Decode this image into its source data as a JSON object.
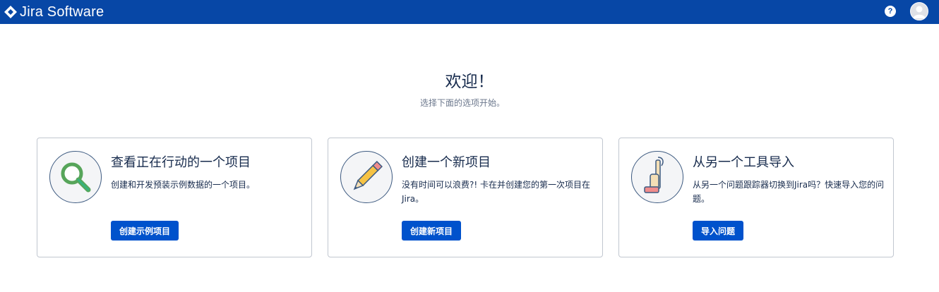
{
  "header": {
    "app_name": "Jira Software",
    "help_label": "?",
    "colors": {
      "bar": "#0747a6",
      "button": "#0052cc"
    }
  },
  "welcome": {
    "title": "欢迎！",
    "subtitle": "选择下面的选项开始。"
  },
  "cards": [
    {
      "icon": "magnifier-icon",
      "title": "查看正在行动的一个项目",
      "description": "创建和开发预装示例数据的一个项目。",
      "button": "创建示例项目"
    },
    {
      "icon": "pencil-icon",
      "title": "创建一个新项目",
      "description": "没有时间可以浪费?! 卡在并创建您的第一次项目在 Jira。",
      "button": "创建新项目"
    },
    {
      "icon": "vacuum-icon",
      "title": "从另一个工具导入",
      "description": "从另一个问题跟踪器切换到Jira吗？快速导入您的问题。",
      "button": "导入问题"
    }
  ]
}
